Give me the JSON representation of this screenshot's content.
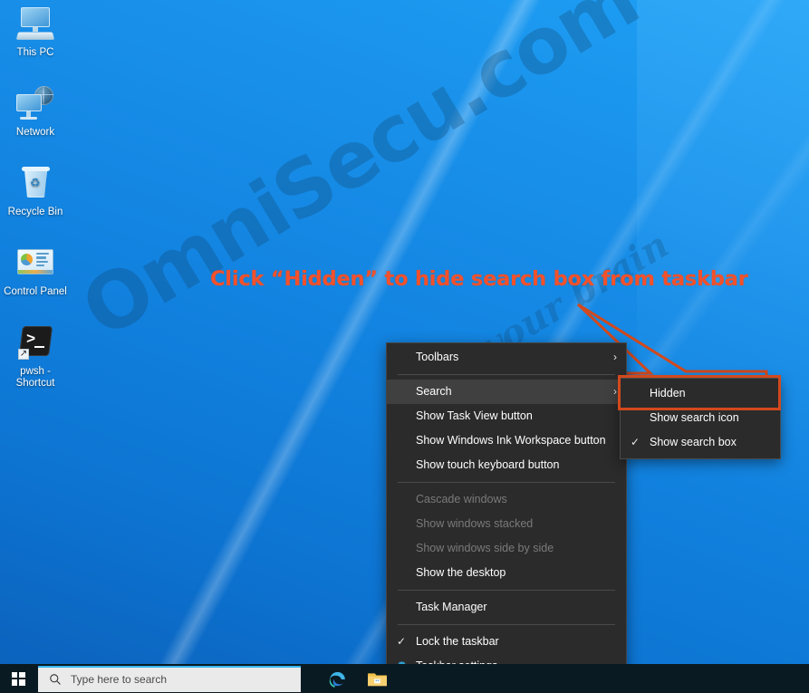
{
  "desktop": {
    "icons": [
      {
        "name": "this-pc",
        "label": "This PC"
      },
      {
        "name": "network",
        "label": "Network"
      },
      {
        "name": "recycle-bin",
        "label": "Recycle Bin"
      },
      {
        "name": "control-panel",
        "label": "Control Panel"
      },
      {
        "name": "pwsh-shortcut",
        "label": "pwsh - Shortcut"
      }
    ],
    "watermark": {
      "main": "OmniSecu.com",
      "sub": "feed your brain"
    }
  },
  "annotation": {
    "text": "Click “Hidden” to hide search box from taskbar",
    "color": "#f2512c"
  },
  "context_menu": {
    "items": [
      {
        "label": "Toolbars",
        "submenu": true,
        "checked": false,
        "disabled": false,
        "highlighted": false,
        "icon": "chevron-right-icon"
      },
      {
        "label": "Search",
        "submenu": true,
        "checked": false,
        "disabled": false,
        "highlighted": true,
        "icon": "chevron-right-icon"
      },
      {
        "label": "Show Task View button",
        "submenu": false,
        "checked": false,
        "disabled": false,
        "highlighted": false,
        "icon": ""
      },
      {
        "label": "Show Windows Ink Workspace button",
        "submenu": false,
        "checked": false,
        "disabled": false,
        "highlighted": false,
        "icon": ""
      },
      {
        "label": "Show touch keyboard button",
        "submenu": false,
        "checked": false,
        "disabled": false,
        "highlighted": false,
        "icon": ""
      },
      {
        "label": "Cascade windows",
        "submenu": false,
        "checked": false,
        "disabled": true,
        "highlighted": false,
        "icon": ""
      },
      {
        "label": "Show windows stacked",
        "submenu": false,
        "checked": false,
        "disabled": true,
        "highlighted": false,
        "icon": ""
      },
      {
        "label": "Show windows side by side",
        "submenu": false,
        "checked": false,
        "disabled": true,
        "highlighted": false,
        "icon": ""
      },
      {
        "label": "Show the desktop",
        "submenu": false,
        "checked": false,
        "disabled": false,
        "highlighted": false,
        "icon": ""
      },
      {
        "label": "Task Manager",
        "submenu": false,
        "checked": false,
        "disabled": false,
        "highlighted": false,
        "icon": ""
      },
      {
        "label": "Lock the taskbar",
        "submenu": false,
        "checked": true,
        "disabled": false,
        "highlighted": false,
        "icon": "checkmark-icon"
      },
      {
        "label": "Taskbar settings",
        "submenu": false,
        "checked": false,
        "disabled": false,
        "highlighted": false,
        "icon": "gear-icon"
      }
    ]
  },
  "search_submenu": {
    "items": [
      {
        "label": "Hidden",
        "checked": false,
        "highlighted": true
      },
      {
        "label": "Show search icon",
        "checked": false,
        "highlighted": false
      },
      {
        "label": "Show search box",
        "checked": true,
        "highlighted": false
      }
    ],
    "highlight_color": "#d2491d"
  },
  "taskbar": {
    "start_label": "Start",
    "search_placeholder": "Type here to search",
    "apps": [
      {
        "name": "microsoft-edge",
        "label": "Microsoft Edge"
      },
      {
        "name": "file-explorer",
        "label": "File Explorer"
      }
    ]
  }
}
